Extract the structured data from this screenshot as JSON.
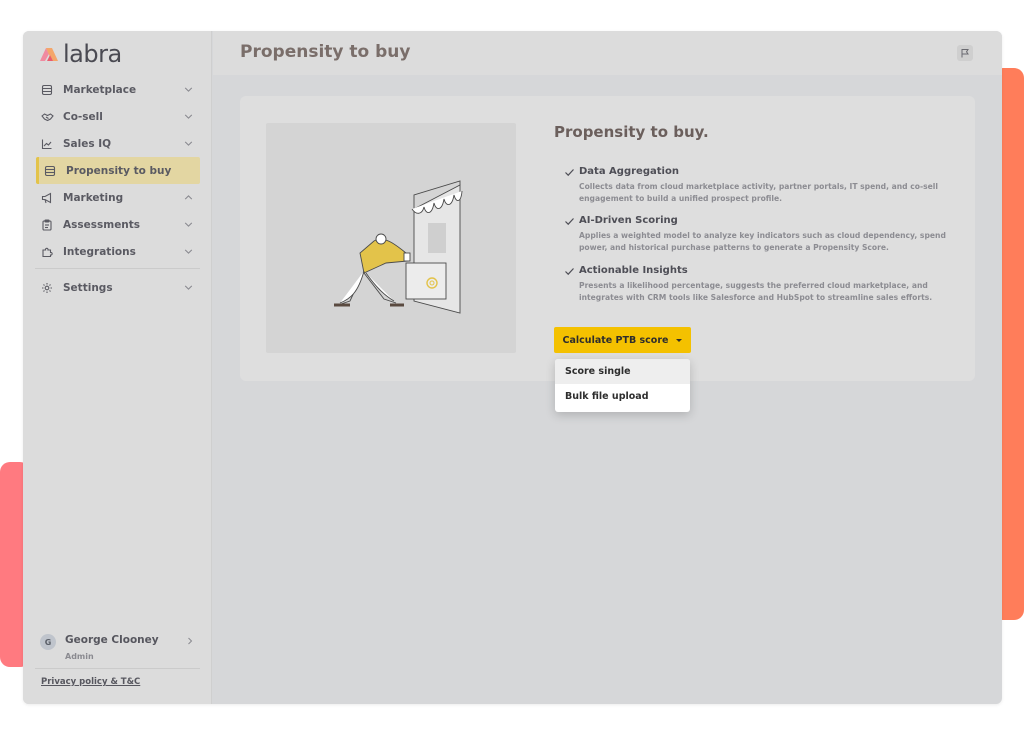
{
  "app": {
    "logo_text": "labra",
    "brand_colors": {
      "logo_pink": "#f08aa0",
      "logo_orange": "#f4a66a",
      "accent_yellow": "#f4c100"
    }
  },
  "sidebar": {
    "items": [
      {
        "label": "Marketplace",
        "icon": "store-icon",
        "chevron": "down"
      },
      {
        "label": "Co-sell",
        "icon": "handshake-icon",
        "chevron": "down"
      },
      {
        "label": "Sales IQ",
        "icon": "line-chart-icon",
        "chevron": "down"
      },
      {
        "label": "Propensity to buy",
        "icon": "store-icon",
        "chevron": "none",
        "active": true
      },
      {
        "label": "Marketing",
        "icon": "megaphone-icon",
        "chevron": "up"
      },
      {
        "label": "Assessments",
        "icon": "clipboard-icon",
        "chevron": "down"
      },
      {
        "label": "Integrations",
        "icon": "puzzle-icon",
        "chevron": "down"
      },
      {
        "label": "Settings",
        "icon": "gear-icon",
        "chevron": "down"
      }
    ]
  },
  "user": {
    "initial": "G",
    "name": "George Clooney",
    "role": "Admin"
  },
  "footer": {
    "privacy_link": "Privacy policy & T&C"
  },
  "header": {
    "title": "Propensity to buy",
    "flag_icon": "flag-icon"
  },
  "info": {
    "title": "Propensity to buy.",
    "features": [
      {
        "title": "Data Aggregation",
        "desc": "Collects data from cloud marketplace activity, partner portals, IT spend, and co-sell engagement to build a unified prospect profile."
      },
      {
        "title": "AI-Driven Scoring",
        "desc": "Applies a weighted model to analyze key indicators such as cloud dependency, spend power, and historical purchase patterns to generate a Propensity Score."
      },
      {
        "title": "Actionable Insights",
        "desc": "Presents a likelihood percentage, suggests the preferred cloud marketplace, and integrates with CRM tools like Salesforce and HubSpot to streamline sales efforts."
      }
    ]
  },
  "action": {
    "button_label": "Calculate PTB score",
    "dropdown_items": [
      "Score single",
      "Bulk file upload"
    ]
  }
}
